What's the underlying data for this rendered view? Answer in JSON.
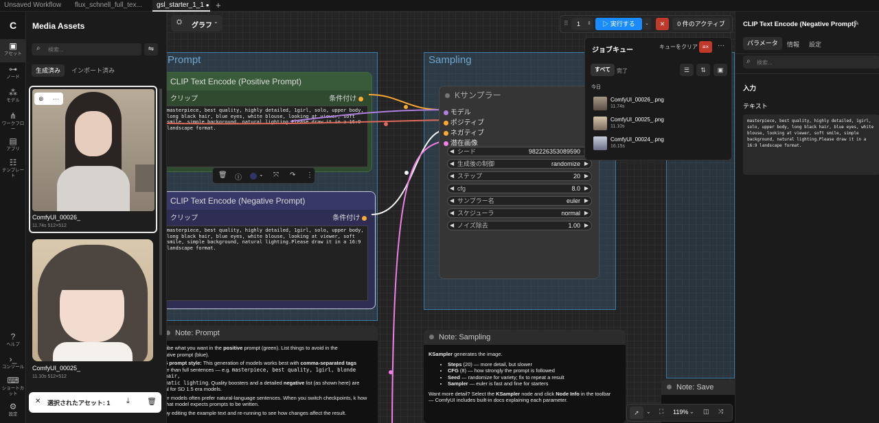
{
  "tabs": [
    "Unsaved Workflow",
    "flux_schnell_full_tex...",
    "gsl_starter_1_1"
  ],
  "tab_modified_dot": "●",
  "rail": [
    {
      "icon": "image-icon",
      "glyph": "▣",
      "label": "アセット"
    },
    {
      "icon": "node-icon",
      "glyph": "⊶",
      "label": "ノード"
    },
    {
      "icon": "model-icon",
      "glyph": "⁂",
      "label": "モデル"
    },
    {
      "icon": "workflow-icon",
      "glyph": "⋔",
      "label": "ワークフロー"
    },
    {
      "icon": "app-icon",
      "glyph": "▤",
      "label": "アプリ"
    },
    {
      "icon": "template-icon",
      "glyph": "☷",
      "label": "テンプレート"
    }
  ],
  "rail_bottom": [
    {
      "icon": "help-icon",
      "glyph": "?",
      "label": "ヘルプ"
    },
    {
      "icon": "console-icon",
      "glyph": "›_",
      "label": "コンソール"
    },
    {
      "icon": "keyboard-icon",
      "glyph": "⌨",
      "label": "ショートカット"
    },
    {
      "icon": "settings-icon",
      "glyph": "⚙",
      "label": "設定"
    }
  ],
  "media": {
    "title": "Media Assets",
    "search_placeholder": "検索...",
    "tab_generated": "生成済み",
    "tab_imported": "インポート済み",
    "assets": [
      {
        "name": "ComfyUI_00026_",
        "meta": "11.74s 512×512"
      },
      {
        "name": "ComfyUI_00025_",
        "meta": "11.10s 512×512"
      }
    ],
    "selected_label": "選択されたアセット: 1"
  },
  "toolbar": {
    "graph_label": "グラフ",
    "batch_count": "1",
    "run_label": "実行する",
    "active_label": "0 件のアクティブ"
  },
  "groups": {
    "prompt": "Prompt",
    "sampling": "Sampling"
  },
  "positive_node": {
    "title": "CLIP Text Encode (Positive Prompt)",
    "input": "クリップ",
    "output": "条件付け",
    "text": "masterpiece, best quality, highly detailed, 1girl, solo, upper body, long black hair, blue eyes, white blouse, looking at viewer, soft smile, simple background, natural lighting.Please draw it in a 16:9 landscape format."
  },
  "negative_node": {
    "title": "CLIP Text Encode (Negative Prompt)",
    "input": "クリップ",
    "output": "条件付け",
    "text": "masterpiece, best quality, highly detailed, 1girl, solo, upper body, long black hair, blue eyes, white blouse, looking at viewer, soft smile, simple background, natural lighting.Please draw it in a 16:9 landscape format."
  },
  "ksampler": {
    "title": "Kサンプラー",
    "inputs": [
      "モデル",
      "ポジティブ",
      "ネガティブ",
      "潜在画像"
    ],
    "output_partial": "潜",
    "widgets": [
      {
        "label": "シード",
        "value": "982226353089590"
      },
      {
        "label": "生成後の制御",
        "value": "randomize"
      },
      {
        "label": "ステップ",
        "value": "20"
      },
      {
        "label": "cfg",
        "value": "8.0"
      },
      {
        "label": "サンプラー名",
        "value": "euler"
      },
      {
        "label": "スケジューラ",
        "value": "normal"
      },
      {
        "label": "ノイズ除去",
        "value": "1.00"
      }
    ]
  },
  "note_prompt": {
    "title": "Note: Prompt",
    "p1_a": "ribe what you want in the ",
    "p1_b": "positive",
    "p1_c": " prompt (green). List things to avoid in the",
    "p1_d": "ative prompt (blue).",
    "p2_a": "5 prompt style:",
    "p2_b": " This generation of models works best with ",
    "p2_c": "comma-separated tags",
    "p2_d": "er than full sentences — e.g. ",
    "p2_e": "masterpiece, best quality, 1girl, blonde hair,",
    "p2_f": "matic lighting",
    "p2_g": ". Quality boosters and a detailed ",
    "p2_h": "negative",
    "p2_i": " list (as shown here) are",
    "p2_j": "al for SD 1.5 era models.",
    "p3": "er models often prefer natural-language sentences. When you switch checkpoints, k how that model expects prompts to be written.",
    "p4": "by editing the example text and re-running to see how changes affect the result."
  },
  "note_sampling": {
    "title": "Note: Sampling",
    "intro_b": "KSampler",
    "intro": " generates the image.",
    "items": [
      {
        "b": "Steps",
        "t": " (20) — more detail, but slower"
      },
      {
        "b": "CFG",
        "t": " (8) — how strongly the prompt is followed"
      },
      {
        "b": "Seed",
        "t": " — randomize for variety; fix to repeat a result"
      },
      {
        "b": "Sampler",
        "t": " — euler is fast and fine for starters"
      }
    ],
    "more_a": "Want more detail? Select the ",
    "more_b": "KSampler",
    "more_c": " node and click ",
    "more_d": "Node Info",
    "more_e": " in the toolbar",
    "more_f": "— ComfyUI includes built-in docs explaining each parameter."
  },
  "note_save": {
    "title": "Note: Save"
  },
  "zoom": "119%",
  "queue": {
    "title": "ジョブキュー",
    "clear_label": "キューをクリア",
    "filter_all": "すべて",
    "filter_done": "完了",
    "today": "今日",
    "jobs": [
      {
        "name": "ComfyUI_00026_.png",
        "time": "11.74s"
      },
      {
        "name": "ComfyUI_00025_.png",
        "time": "11.10s"
      },
      {
        "name": "ComfyUI_00024_.png",
        "time": "16.15s"
      }
    ]
  },
  "right_panel": {
    "title": "CLIP Text Encode (Negative Prompt)",
    "tabs": [
      "パラメータ",
      "情報",
      "設定"
    ],
    "search_placeholder": "検索...",
    "section_input": "入力",
    "field_text": "テキスト",
    "text": "masterpiece, best quality, highly detailed, 1girl, solo, upper body, long black hair, blue eyes, white blouse, looking at viewer, soft smile, simple background, natural lighting.Please draw it in a 16:9 landscape format."
  },
  "colors": {
    "accent": "#1a8cff",
    "positive_node": "#2f4a2f",
    "negative_node": "#2e2e55",
    "danger": "#c0392b"
  }
}
